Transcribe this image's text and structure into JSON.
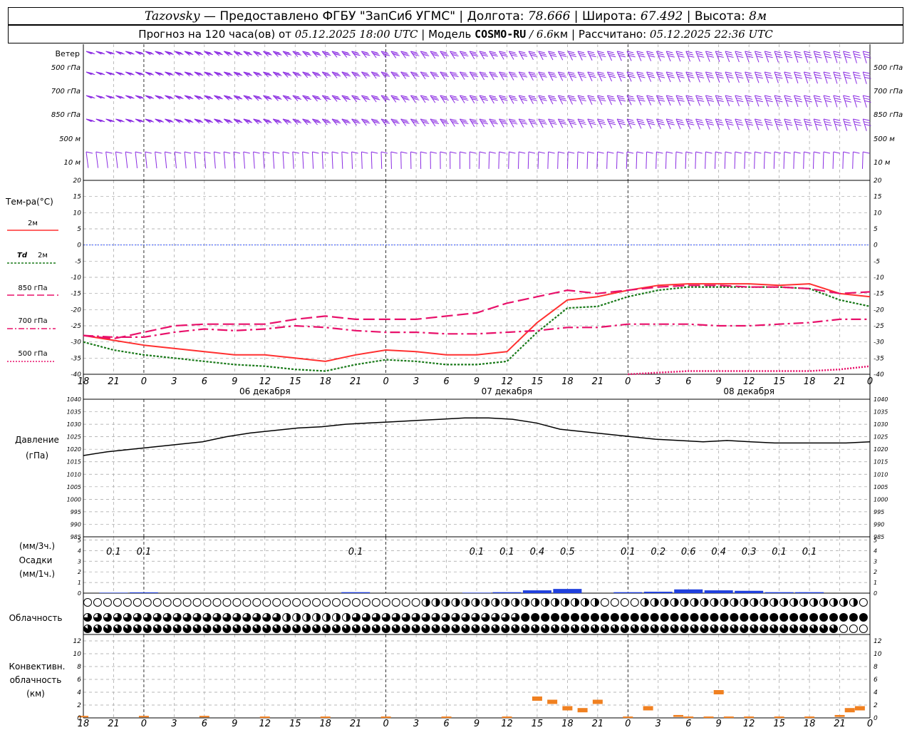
{
  "header": {
    "station": "Tazovsky",
    "dash": "—",
    "provider": "Предоставлено ФГБУ \"ЗапСиб УГМС\"",
    "lon_label": "Долгота:",
    "lon_value": "78.666",
    "lat_label": "Широта:",
    "lat_value": "67.492",
    "alt_label": "Высота:",
    "alt_value": "8м",
    "forecast_label": "Прогноз на 120 часа(ов) от",
    "forecast_start": "05.12.2025 18:00 UTC",
    "model_label": "Модель",
    "model_name": "COSMO-RU",
    "model_res": "/ 6.6",
    "model_res_unit": "км",
    "calc_label": "Рассчитано:",
    "calc_time": "05.12.2025 22:36 UTC",
    "sep": "|"
  },
  "colors": {
    "wind": "#8a2be2",
    "t2m": "#ff3030",
    "td2m": "#1a7a1a",
    "t850": "#e8106a",
    "t700": "#e8106a",
    "t500": "#e8106a",
    "zero_line": "#3050ff",
    "pressure": "#000000",
    "precip": "#1f3fdd",
    "convective": "#f08020",
    "grid": "#a0a0a0"
  },
  "time_axis": {
    "ticks": [
      "18",
      "21",
      "0",
      "3",
      "6",
      "9",
      "12",
      "15",
      "18",
      "21",
      "0",
      "3",
      "6",
      "9",
      "12",
      "15",
      "18",
      "21",
      "0",
      "3",
      "6",
      "9",
      "12",
      "15",
      "18",
      "21",
      "0"
    ],
    "dates": [
      "06 декабря",
      "07 декабря",
      "08 декабря"
    ]
  },
  "wind_panel": {
    "title": "Ветер",
    "levels": [
      "500 гПа",
      "700 гПа",
      "850 гПа",
      "500 м",
      "10 м"
    ]
  },
  "temp_panel": {
    "title": "Тем-ра(°C)",
    "legend": {
      "t2m": "2м",
      "td_symbol": "Td",
      "td": "2м",
      "t850": "850 гПа",
      "t700": "700 гПа",
      "t500": "500 гПа"
    },
    "yticks": [
      "20",
      "15",
      "10",
      "5",
      "0",
      "-5",
      "-10",
      "-15",
      "-20",
      "-25",
      "-30",
      "-35",
      "-40"
    ]
  },
  "pressure_panel": {
    "title": "Давление",
    "unit": "(гПа)",
    "yticks": [
      "1040",
      "1035",
      "1030",
      "1025",
      "1020",
      "1015",
      "1010",
      "1005",
      "1000",
      "995",
      "990",
      "985"
    ]
  },
  "precip_panel": {
    "unit3": "(мм/3ч.)",
    "title": "Осадки",
    "unit1": "(мм/1ч.)",
    "yticks": [
      "5",
      "4",
      "3",
      "2",
      "1",
      "0"
    ],
    "labels": [
      {
        "h": 3,
        "text": "0.1"
      },
      {
        "h": 6,
        "text": "0.1"
      },
      {
        "h": 27,
        "text": "0.1"
      },
      {
        "h": 39,
        "text": "0.1"
      },
      {
        "h": 42,
        "text": "0.1"
      },
      {
        "h": 45,
        "text": "0.4"
      },
      {
        "h": 48,
        "text": "0.5"
      },
      {
        "h": 54,
        "text": "0.1"
      },
      {
        "h": 57,
        "text": "0.2"
      },
      {
        "h": 60,
        "text": "0.6"
      },
      {
        "h": 63,
        "text": "0.4"
      },
      {
        "h": 66,
        "text": "0.3"
      },
      {
        "h": 69,
        "text": "0.1"
      },
      {
        "h": 72,
        "text": "0.1"
      }
    ]
  },
  "cloud_panel": {
    "title": "Облачность"
  },
  "conv_panel": {
    "title1": "Конвективн.",
    "title2": "облачность",
    "unit": "(км)",
    "yticks": [
      "12",
      "10",
      "8",
      "6",
      "4",
      "2",
      "0"
    ]
  },
  "chart_data": [
    {
      "type": "line",
      "title": "Тем-ра(°C)",
      "xlabel": "",
      "ylabel": "Тем-ра(°C)",
      "ylim": [
        -40,
        20
      ],
      "x_hours_from_start": [
        0,
        3,
        6,
        9,
        12,
        15,
        18,
        21,
        24,
        27,
        30,
        33,
        36,
        39,
        42,
        45,
        48,
        51,
        54,
        57,
        60,
        63,
        66,
        69,
        72,
        75,
        78
      ],
      "series": [
        {
          "name": "2м",
          "values": [
            -28,
            -29.5,
            -31,
            -32,
            -33,
            -34,
            -34,
            -35,
            -36,
            -34,
            -32.5,
            -33,
            -34,
            -34,
            -33,
            -24,
            -17,
            -16,
            -14,
            -12.5,
            -12,
            -12,
            -12,
            -12.5,
            -12,
            -15,
            -16
          ]
        },
        {
          "name": "Td 2м",
          "values": [
            -30,
            -32.5,
            -34,
            -35,
            -36,
            -37,
            -37.5,
            -38.5,
            -39,
            -37,
            -35.5,
            -36,
            -37,
            -37,
            -36,
            -27,
            -19.5,
            -19,
            -16,
            -14,
            -13,
            -13,
            -13,
            -13,
            -13.5,
            -17,
            -19
          ]
        },
        {
          "name": "850 гПа",
          "values": [
            -28,
            -29,
            -27,
            -25,
            -24.5,
            -24.5,
            -24.5,
            -23,
            -22,
            -23,
            -23,
            -23,
            -22,
            -21,
            -18,
            -16,
            -14,
            -15,
            -14,
            -13,
            -12.5,
            -12.5,
            -13,
            -13,
            -13.5,
            -15,
            -14.5
          ]
        },
        {
          "name": "700 гПа",
          "values": [
            -28,
            -28.5,
            -28.5,
            -27,
            -26,
            -26.5,
            -26,
            -25,
            -25.5,
            -26.5,
            -27,
            -27,
            -27.5,
            -27.5,
            -27,
            -26.5,
            -25.5,
            -25.5,
            -24.5,
            -24.5,
            -24.5,
            -25,
            -25,
            -24.5,
            -24,
            -23,
            -23
          ]
        },
        {
          "name": "500 гПа",
          "values": [
            null,
            null,
            null,
            null,
            null,
            null,
            null,
            null,
            null,
            null,
            null,
            null,
            null,
            null,
            null,
            null,
            null,
            null,
            -40,
            -39.5,
            -39,
            -39,
            -39,
            -39,
            -39,
            -38.5,
            -37.5
          ]
        }
      ]
    },
    {
      "type": "line",
      "title": "Давление",
      "xlabel": "",
      "ylabel": "Давление (гПа)",
      "ylim": [
        985,
        1040
      ],
      "x_hours_from_start": [
        0,
        3,
        6,
        9,
        12,
        15,
        18,
        21,
        24,
        27,
        30,
        33,
        36,
        39,
        42,
        45,
        48,
        51,
        54,
        57,
        60,
        63,
        66,
        69,
        72,
        75,
        78
      ],
      "series": [
        {
          "name": "",
          "values": [
            1017.5,
            1019,
            1020,
            1021,
            1022,
            1023,
            1025,
            1026.5,
            1027.5,
            1028.5,
            1029,
            1030,
            1030.5,
            1031,
            1031.5,
            1032,
            1032.5,
            1032.5,
            1032,
            1030.5,
            1028,
            1027,
            1026,
            1025,
            1024,
            1023.5,
            1023,
            1023.5,
            1023,
            1022.5,
            1022.5,
            1022.5,
            1022.5,
            1023
          ]
        }
      ]
    },
    {
      "type": "bar",
      "title": "Осадки",
      "ylabel": "(мм/1ч.)",
      "ylim": [
        0,
        5
      ],
      "x_hours_from_start": [
        3,
        6,
        27,
        39,
        42,
        45,
        48,
        54,
        57,
        60,
        63,
        66,
        69,
        72
      ],
      "values": [
        0.05,
        0.08,
        0.1,
        0.05,
        0.1,
        0.3,
        0.45,
        0.1,
        0.15,
        0.4,
        0.3,
        0.25,
        0.1,
        0.1
      ]
    },
    {
      "type": "bar",
      "title": "Конвективн. облачность (км)",
      "ylabel": "(км)",
      "ylim": [
        0,
        13
      ],
      "x_hours_from_start": [
        0,
        6,
        12,
        18,
        24,
        30,
        36,
        42,
        45,
        46.5,
        48,
        49.5,
        51,
        54,
        56,
        59,
        60,
        62,
        63,
        64,
        66,
        69,
        72,
        75,
        76,
        77
      ],
      "values": [
        0.2,
        0.2,
        0.2,
        0.1,
        0.1,
        0.1,
        0.1,
        0.1,
        3,
        2.5,
        1.5,
        1.2,
        2.5,
        0.1,
        1.5,
        0.3,
        0.1,
        0.1,
        4,
        0.1,
        0.1,
        0.1,
        0.1,
        0.3,
        1.2,
        1.5
      ]
    }
  ]
}
